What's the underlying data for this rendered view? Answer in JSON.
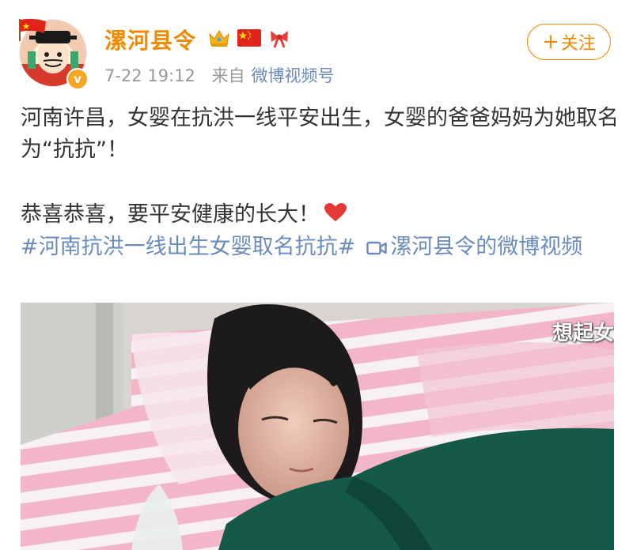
{
  "header": {
    "username": "漯河县令",
    "timestamp": "7-22 19:12",
    "source_prefix": "来自",
    "source": "微博视频号",
    "follow_label": "关注",
    "follow_icon": "plus-icon",
    "badges": [
      "crown-icon",
      "china-flag-icon",
      "bow-icon"
    ],
    "avatar_badge": "v",
    "username_color": "#f08a00"
  },
  "post": {
    "line1": "河南许昌，女婴在抗洪一线平安出生，女婴的爸爸妈妈为她取名为“抗抗”！",
    "line2": "恭喜恭喜，要平安健康的长大！",
    "hashtag": "#河南抗洪一线出生女婴取名抗抗#",
    "video_link": "漯河县令的微博视频",
    "link_color": "#6a8bbd"
  },
  "video": {
    "subtitle": "想起女"
  }
}
